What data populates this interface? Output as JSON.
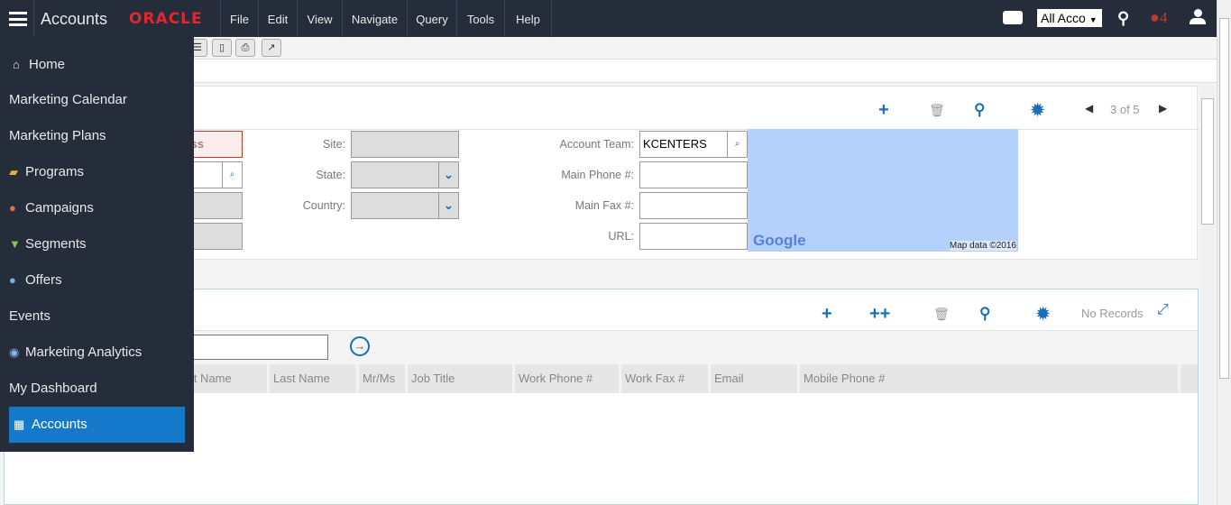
{
  "header": {
    "title": "Accounts",
    "brand": "ORACLE",
    "menu": [
      "File",
      "Edit",
      "View",
      "Navigate",
      "Query",
      "Tools",
      "Help"
    ],
    "scope_select": "All Acco",
    "alert_count": "4",
    "brand_color": "#e0282e"
  },
  "sidebar": {
    "items": [
      {
        "label": "Home",
        "icon": "home-icon"
      },
      {
        "label": "Marketing Calendar"
      },
      {
        "label": "Marketing Plans"
      },
      {
        "label": "Programs",
        "icon": "programs-icon"
      },
      {
        "label": "Campaigns",
        "icon": "campaigns-icon"
      },
      {
        "label": "Segments",
        "icon": "segments-icon"
      },
      {
        "label": "Offers",
        "icon": "offers-icon"
      },
      {
        "label": "Events"
      },
      {
        "label": "Marketing Analytics",
        "icon": "analytics-icon"
      },
      {
        "label": "My Dashboard"
      },
      {
        "label": "Accounts",
        "icon": "accounts-icon",
        "active": true
      }
    ]
  },
  "form": {
    "pager": "3 of 5",
    "name_partial": "ss",
    "site_label": "Site:",
    "state_label": "State:",
    "country_label": "Country:",
    "team_label": "Account Team:",
    "team_value": "KCENTERS",
    "phone_label": "Main Phone #:",
    "fax_label": "Main Fax #:",
    "url_label": "URL:",
    "map_logo": "Google",
    "map_credit": "Map data ©2016"
  },
  "contacts": {
    "status": "No Records",
    "columns": [
      "rst Name",
      "Last Name",
      "Mr/Ms",
      "Job Title",
      "Work Phone #",
      "Work Fax #",
      "Email",
      "Mobile Phone #"
    ]
  }
}
